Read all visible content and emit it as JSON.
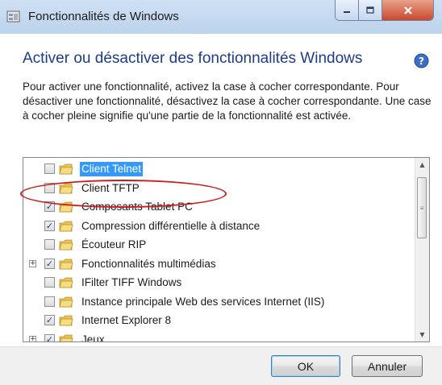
{
  "window": {
    "title": "Fonctionnalités de Windows",
    "buttons": [
      "minimize",
      "maximize",
      "close"
    ]
  },
  "main": {
    "heading": "Activer ou désactiver des fonctionnalités Windows",
    "description": "Pour activer une fonctionnalité, activez la case à cocher correspondante. Pour désactiver une fonctionnalité, désactivez la case à cocher correspondante. Une case à cocher pleine signifie qu'une partie de la fonctionnalité est activée."
  },
  "features": [
    {
      "label": "Client Telnet",
      "checked": false,
      "expandable": false,
      "selected": true
    },
    {
      "label": "Client TFTP",
      "checked": false,
      "expandable": false,
      "selected": false
    },
    {
      "label": "Composants Tablet PC",
      "checked": true,
      "expandable": false,
      "selected": false
    },
    {
      "label": "Compression différentielle à distance",
      "checked": true,
      "expandable": false,
      "selected": false
    },
    {
      "label": "Écouteur RIP",
      "checked": false,
      "expandable": false,
      "selected": false
    },
    {
      "label": "Fonctionnalités multimédias",
      "checked": true,
      "expandable": true,
      "selected": false
    },
    {
      "label": "IFilter TIFF Windows",
      "checked": false,
      "expandable": false,
      "selected": false
    },
    {
      "label": "Instance principale Web des services Internet (IIS)",
      "checked": false,
      "expandable": false,
      "selected": false
    },
    {
      "label": "Internet Explorer 8",
      "checked": true,
      "expandable": false,
      "selected": false
    },
    {
      "label": "Jeux",
      "checked": true,
      "expandable": true,
      "selected": false
    }
  ],
  "footer": {
    "ok_label": "OK",
    "cancel_label": "Annuler"
  },
  "colors": {
    "heading": "#1e3c8c",
    "selection": "#3399ff",
    "annotation": "#cc1b1b"
  }
}
